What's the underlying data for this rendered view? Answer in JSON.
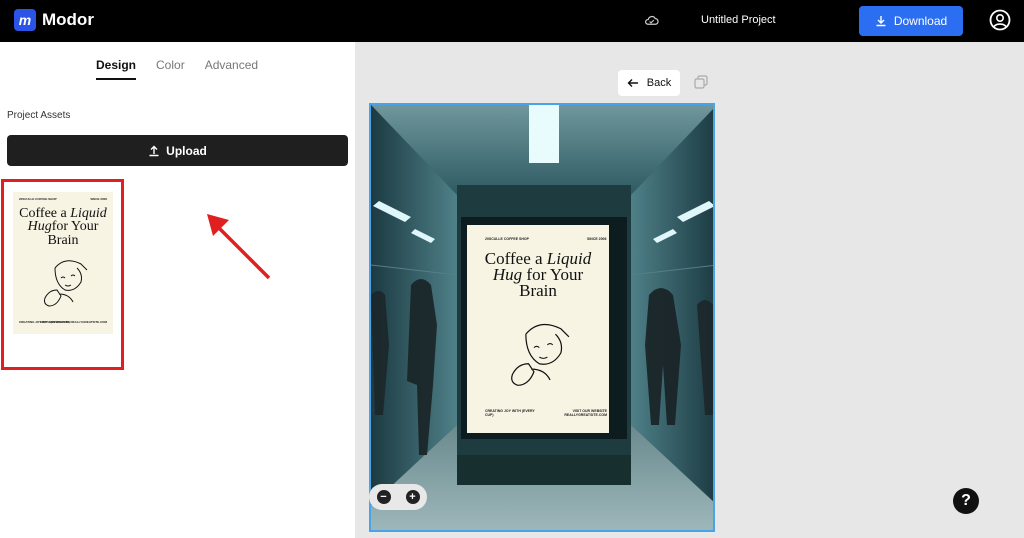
{
  "app": {
    "brand_letter": "m",
    "brand_name": "Modor",
    "project_title": "Untitled Project",
    "download_label": "Download"
  },
  "left_panel": {
    "tabs": [
      {
        "label": "Design",
        "active": true
      },
      {
        "label": "Color",
        "active": false
      },
      {
        "label": "Advanced",
        "active": false
      }
    ],
    "assets_label": "Project Assets",
    "upload_label": "Upload"
  },
  "poster": {
    "shop": "20SCULLE COFFEE SHOP",
    "since": "SINCE 2006",
    "line1": "Coffee a",
    "line1_italic": "Liquid",
    "line2_italic": "Hug",
    "line2": "for Your",
    "line3": "Brain",
    "foot_left": "CREATING JOY WITH (EVERY CUP)",
    "foot_right": "VISIT OUR WEBSITE REALLYGREATSITE.COM"
  },
  "canvas": {
    "back_label": "Back",
    "zoom_out": "−",
    "zoom_in": "+",
    "help": "?"
  },
  "colors": {
    "accent": "#2b6ef2",
    "highlight_box": "#e02020",
    "selection": "#4aa3e8"
  },
  "icons": [
    "cloud-icon",
    "download-icon",
    "account-icon",
    "upload-icon",
    "back-arrow-icon",
    "copy-icon",
    "zoom-out-icon",
    "zoom-in-icon",
    "help-icon"
  ]
}
